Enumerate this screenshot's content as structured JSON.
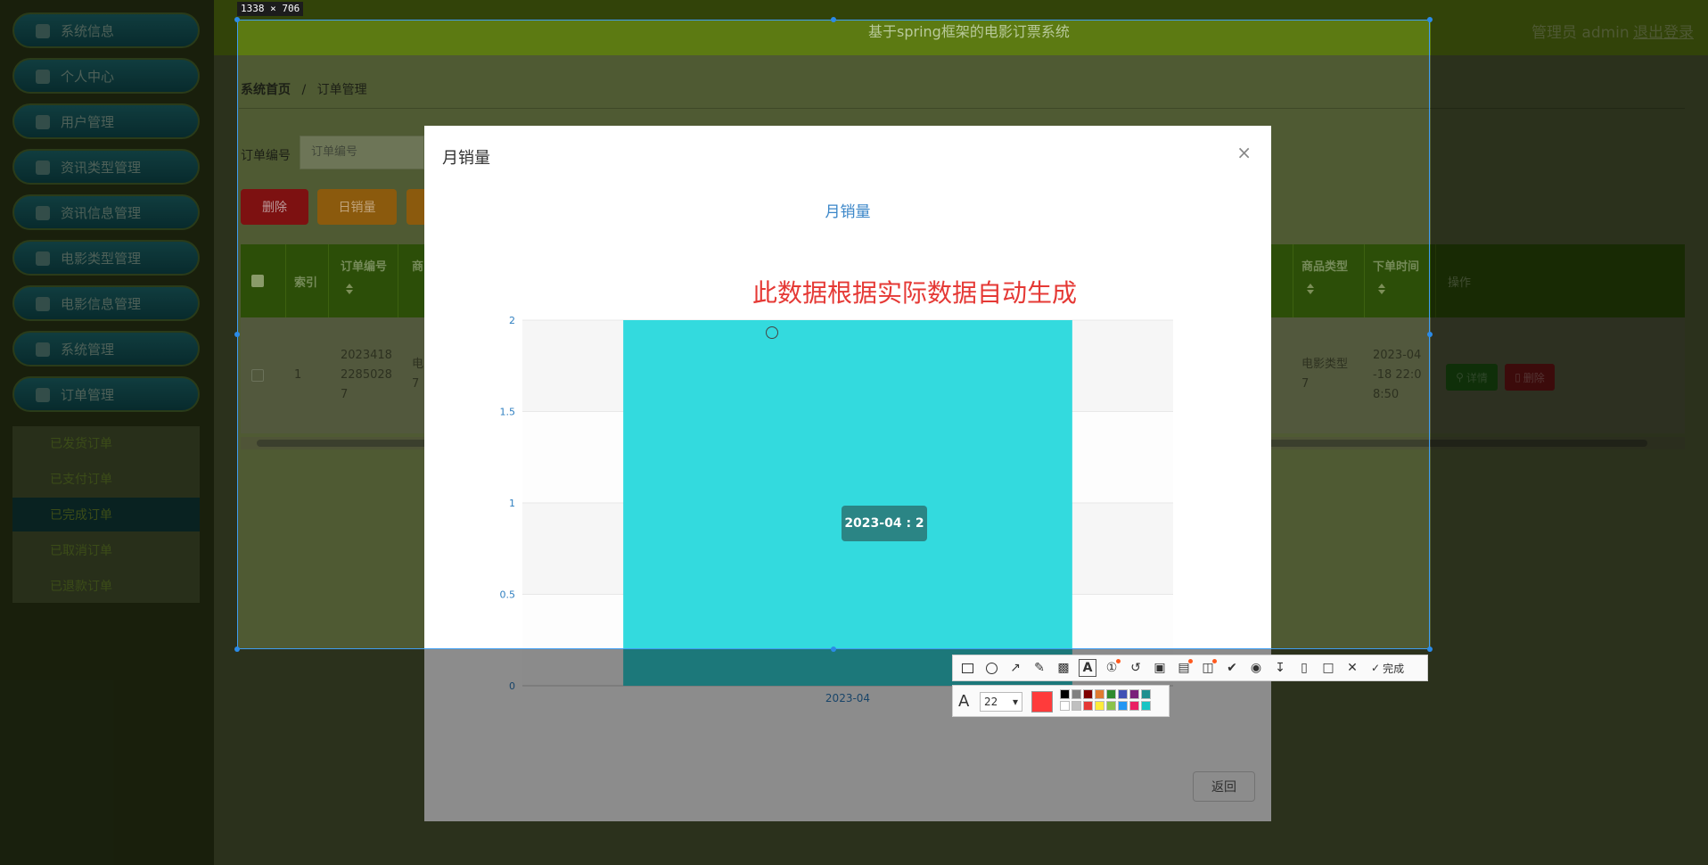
{
  "sidebar": {
    "items": [
      {
        "label": "系统信息",
        "icon": "home-icon"
      },
      {
        "label": "个人中心",
        "icon": "user-icon"
      },
      {
        "label": "用户管理",
        "icon": "briefcase-icon"
      },
      {
        "label": "资讯类型管理",
        "icon": "cup-icon"
      },
      {
        "label": "资讯信息管理",
        "icon": "grid-icon"
      },
      {
        "label": "电影类型管理",
        "icon": "grid-icon"
      },
      {
        "label": "电影信息管理",
        "icon": "clipboard-icon"
      },
      {
        "label": "系统管理",
        "icon": "flag-icon"
      },
      {
        "label": "订单管理",
        "icon": "grid-icon"
      }
    ],
    "subitems": [
      "已发货订单",
      "已支付订单",
      "已完成订单",
      "已取消订单",
      "已退款订单"
    ]
  },
  "header": {
    "system_title": "基于spring框架的电影订票系统",
    "admin_label": "管理员 admin",
    "logout_label": "退出登录"
  },
  "breadcrumb": {
    "home": "系统首页",
    "separator": "/",
    "current": "订单管理"
  },
  "search": {
    "label": "订单编号",
    "placeholder": "订单编号"
  },
  "toolbar": {
    "delete_label": "删除",
    "daily_sales_label": "日销量"
  },
  "table": {
    "columns": [
      "索引",
      "订单编号",
      "商",
      "商品类型",
      "下单时间",
      "操作"
    ],
    "rows": [
      {
        "index": "1",
        "order_no_lines": [
          "2023418",
          "2285028",
          "7"
        ],
        "product_lines": [
          "电",
          "7"
        ],
        "type_lines": [
          "电影类型",
          "7"
        ],
        "time_lines": [
          "2023-04",
          "-18 22:0",
          "8:50"
        ],
        "detail_label": "详情",
        "delete_label": "删除"
      }
    ]
  },
  "modal": {
    "title": "月销量",
    "close_symbol": "×",
    "return_label": "返回"
  },
  "chart_data": {
    "type": "bar",
    "title": "月销量",
    "categories": [
      "2023-04"
    ],
    "values": [
      2
    ],
    "yticks": [
      "0",
      "0.5",
      "1",
      "1.5",
      "2"
    ],
    "ylim": [
      0,
      2
    ],
    "grid": true,
    "annotation": "此数据根据实际数据自动生成",
    "tooltip": "2023-04 : 2",
    "bar_color": "#33dade"
  },
  "snipping_tool": {
    "size_label": "1338 × 706",
    "done_label": "完成",
    "font_size": "22",
    "selected_color": "#ff3b3b",
    "palette": [
      "#000000",
      "#808080",
      "#800000",
      "#e07a30",
      "#2e8b2e",
      "#3f51b5",
      "#7a1f7a",
      "#1f8f8f",
      "#ffffff",
      "#c0c0c0",
      "#e53935",
      "#ffeb3b",
      "#8bc34a",
      "#2196f3",
      "#e91e63",
      "#19c4c4"
    ],
    "tools": [
      "rectangle-icon",
      "ellipse-icon",
      "arrow-icon",
      "pencil-icon",
      "mosaic-icon",
      "text-icon",
      "number-icon",
      "undo-icon",
      "crop-icon",
      "ocr-icon",
      "screenshot-icon",
      "pin-icon",
      "record-icon",
      "download-icon",
      "phone-icon",
      "bookmark-icon",
      "close-icon"
    ]
  },
  "colors": {
    "accent_green": "#5c7a12",
    "modal_title_blue": "#3a86c8",
    "annotation_red": "#e53935"
  }
}
